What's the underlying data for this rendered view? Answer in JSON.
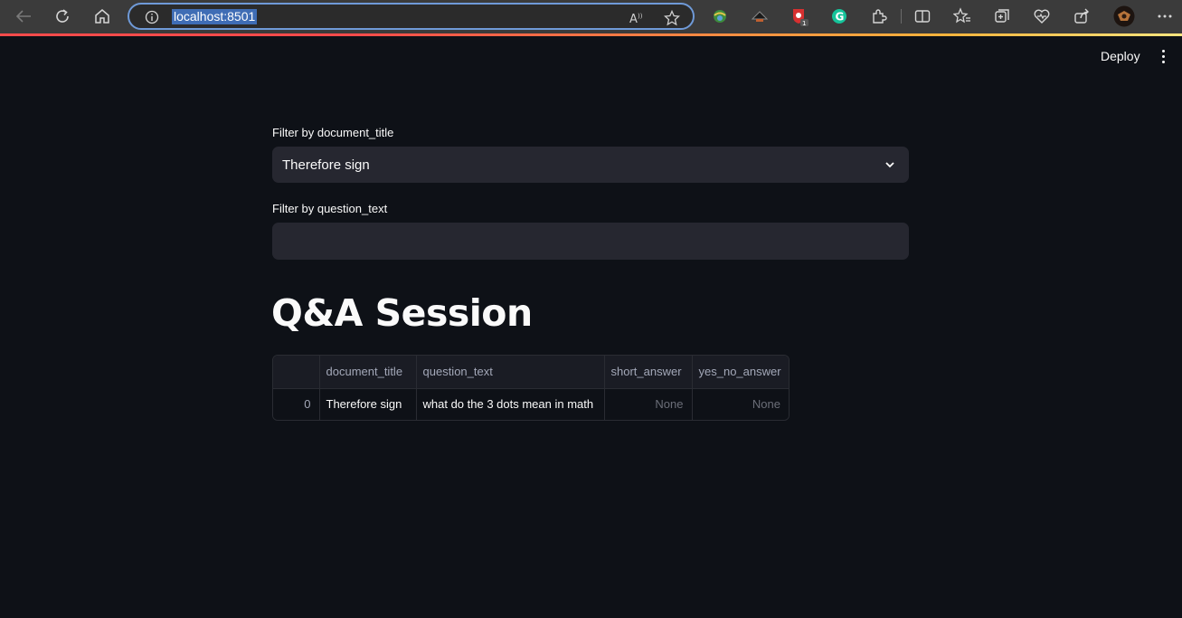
{
  "browser": {
    "url": "localhost:8501",
    "extension_badge": "1"
  },
  "app_header": {
    "deploy_label": "Deploy"
  },
  "filters": {
    "document_title": {
      "label": "Filter by document_title",
      "selected": "Therefore sign"
    },
    "question_text": {
      "label": "Filter by question_text",
      "value": ""
    }
  },
  "page_title": "Q&A Session",
  "table": {
    "columns": [
      "",
      "document_title",
      "question_text",
      "short_answer",
      "yes_no_answer"
    ],
    "rows": [
      {
        "index": "0",
        "document_title": "Therefore sign",
        "question_text": "what do the 3 dots mean in math",
        "short_answer": "None",
        "yes_no_answer": "None"
      }
    ]
  },
  "colors": {
    "background": "#0e1117",
    "input_bg": "#262730",
    "accent": "#ff4b4b",
    "browser_bar": "#3b3b3b"
  }
}
